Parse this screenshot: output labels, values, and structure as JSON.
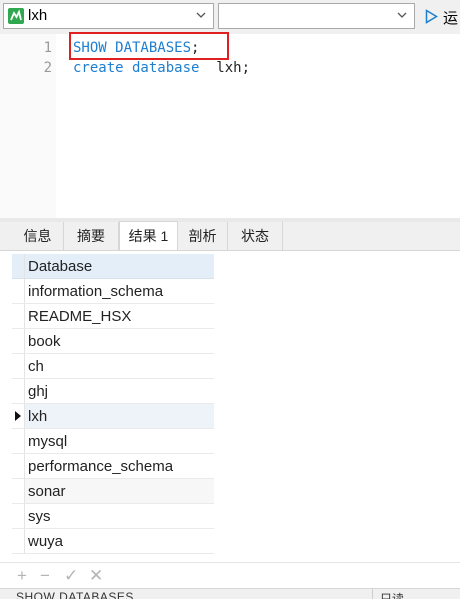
{
  "toolbar": {
    "database": "lxh",
    "schedule": "",
    "run_label": "运"
  },
  "editor": {
    "lines": [
      {
        "number": "1",
        "keyword": "SHOW DATABASES",
        "rest": ";"
      },
      {
        "number": "2",
        "keyword": "create database",
        "rest": "  lxh;"
      }
    ]
  },
  "tabs": [
    "信息",
    "摘要",
    "结果 1",
    "剖析",
    "状态"
  ],
  "active_tab": "结果 1",
  "result": {
    "column": "Database",
    "rows": [
      "information_schema",
      "README_HSX",
      "book",
      "ch",
      "ghj",
      "lxh",
      "mysql",
      "performance_schema",
      "sonar",
      "sys",
      "wuya"
    ],
    "selected": "lxh"
  },
  "actions": {
    "add": "+",
    "remove": "−",
    "apply": "✓",
    "discard": "✕"
  },
  "status": {
    "query": "SHOW DATABASES",
    "right": "只读"
  },
  "colors": {
    "keyword": "#1e7fd0",
    "highlight_border": "#e02020",
    "header_bg": "#e3eef9"
  }
}
